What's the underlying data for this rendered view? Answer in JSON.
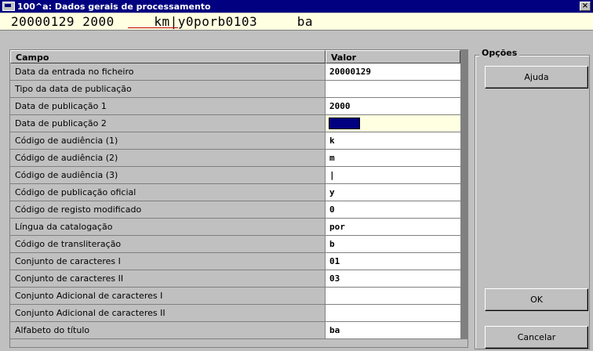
{
  "window": {
    "title": "100^a: Dados gerais de processamento",
    "close_label": "×"
  },
  "record_line": {
    "text": "20000129 2000     km|y0porb0103     ba"
  },
  "grid": {
    "headers": {
      "campo": "Campo",
      "valor": "Valor"
    },
    "rows": [
      {
        "campo": "Data da entrada no ficheiro",
        "valor": "20000129"
      },
      {
        "campo": "Tipo da data de publicação",
        "valor": ""
      },
      {
        "campo": "Data de publicação 1",
        "valor": "2000"
      },
      {
        "campo": "Data de publicação 2",
        "valor": ""
      },
      {
        "campo": "Código de audiência (1)",
        "valor": "k"
      },
      {
        "campo": "Código de audiência (2)",
        "valor": "m"
      },
      {
        "campo": "Código de audiência (3)",
        "valor": "|"
      },
      {
        "campo": "Código de publicação oficial",
        "valor": "y"
      },
      {
        "campo": "Código de registo modificado",
        "valor": "0"
      },
      {
        "campo": "Língua da catalogação",
        "valor": "por"
      },
      {
        "campo": "Código de transliteração",
        "valor": "b"
      },
      {
        "campo": "Conjunto de caracteres I",
        "valor": "01"
      },
      {
        "campo": "Conjunto de caracteres II",
        "valor": "03"
      },
      {
        "campo": "Conjunto Adicional de caracteres I",
        "valor": ""
      },
      {
        "campo": "Conjunto Adicional de caracteres II",
        "valor": ""
      },
      {
        "campo": "Alfabeto do título",
        "valor": "ba"
      }
    ]
  },
  "options": {
    "title": "Opções",
    "ajuda_label": "Ajuda",
    "ok_label": "OK",
    "cancelar_label": "Cancelar"
  },
  "colors": {
    "title_bar": "#000080",
    "record_bg": "#ffffe1",
    "window_bg": "#c0c0c0"
  }
}
